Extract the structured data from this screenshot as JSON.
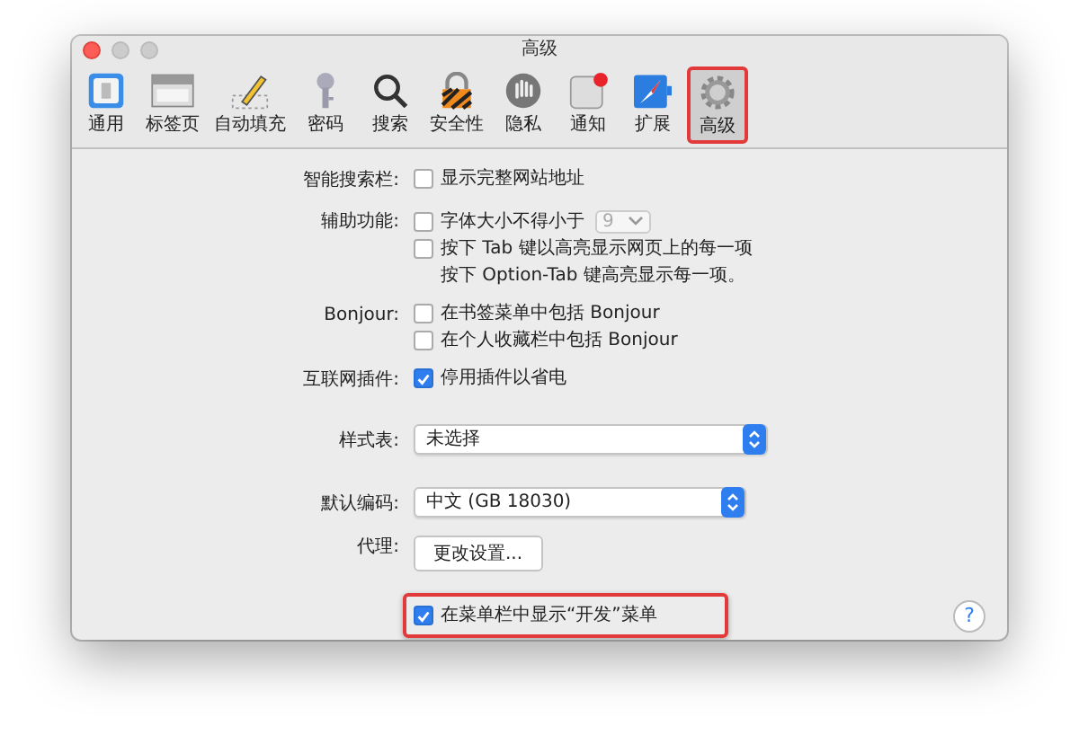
{
  "window": {
    "title": "高级"
  },
  "toolbar": [
    {
      "label": "通用",
      "selected": false,
      "highlighted": false
    },
    {
      "label": "标签页",
      "selected": false,
      "highlighted": false
    },
    {
      "label": "自动填充",
      "selected": false,
      "highlighted": false
    },
    {
      "label": "密码",
      "selected": false,
      "highlighted": false
    },
    {
      "label": "搜索",
      "selected": false,
      "highlighted": false
    },
    {
      "label": "安全性",
      "selected": false,
      "highlighted": false
    },
    {
      "label": "隐私",
      "selected": false,
      "highlighted": false
    },
    {
      "label": "通知",
      "selected": false,
      "highlighted": false
    },
    {
      "label": "扩展",
      "selected": false,
      "highlighted": false
    },
    {
      "label": "高级",
      "selected": true,
      "highlighted": true
    }
  ],
  "sections": [
    {
      "label": "智能搜索栏:",
      "controls": [
        {
          "kind": "checkbox",
          "text": "显示完整网站地址",
          "checked": false
        }
      ]
    },
    {
      "label": "辅助功能:",
      "controls": [
        {
          "kind": "checkbox",
          "text": "字体大小不得小于",
          "checked": false,
          "select": {
            "value": "9",
            "disabled": true
          }
        },
        {
          "kind": "checkbox",
          "text": "按下 Tab 键以高亮显示网页上的每一项",
          "checked": false
        },
        {
          "kind": "note",
          "text": "按下 Option-Tab 键高亮显示每一项。"
        }
      ]
    },
    {
      "label": "Bonjour:",
      "controls": [
        {
          "kind": "checkbox",
          "text": "在书签菜单中包括 Bonjour",
          "checked": false
        },
        {
          "kind": "checkbox",
          "text": "在个人收藏栏中包括 Bonjour",
          "checked": false
        }
      ]
    },
    {
      "label": "互联网插件:",
      "controls": [
        {
          "kind": "checkbox",
          "text": "停用插件以省电",
          "checked": true
        }
      ]
    },
    {
      "label": "样式表:",
      "controls": [
        {
          "kind": "popup",
          "value": "未选择"
        }
      ]
    },
    {
      "label": "默认编码:",
      "controls": [
        {
          "kind": "popup",
          "value": "中文 (GB 18030)"
        }
      ]
    },
    {
      "label": "代理:",
      "controls": [
        {
          "kind": "button",
          "text": "更改设置..."
        }
      ]
    },
    {
      "controls": [
        {
          "kind": "checkbox",
          "text": "在菜单栏中显示“开发”菜单",
          "checked": true,
          "highlighted": true
        }
      ]
    }
  ],
  "help_button": {
    "label": "?"
  }
}
